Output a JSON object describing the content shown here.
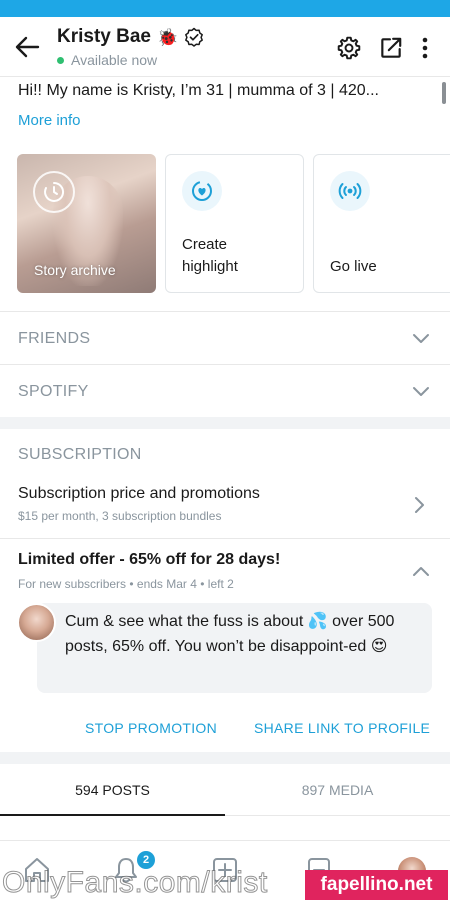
{
  "header": {
    "name": "Kristy Bae",
    "name_emoji": "🐞",
    "status": "Available now"
  },
  "profile": {
    "bio": "Hi!! My name is Kristy, I’m 31 | mumma of 3 | 420...",
    "more_info": "More info"
  },
  "highlights": [
    {
      "label": "Story archive",
      "icon": "clock-archive-icon"
    },
    {
      "label_line1": "Create",
      "label_line2": "highlight",
      "icon": "heart-plus-icon"
    },
    {
      "label": "Go live",
      "icon": "broadcast-icon"
    }
  ],
  "sections": {
    "friends": "FRIENDS",
    "spotify": "SPOTIFY",
    "subscription": "SUBSCRIPTION"
  },
  "subscription": {
    "title": "Subscription price and promotions",
    "desc": "$15 per month, 3 subscription bundles"
  },
  "offer": {
    "title": "Limited offer - 65% off for 28 days!",
    "meta": "For new subscribers  •  ends Mar 4  •  left 2",
    "message": "Cum & see what the fuss is about 💦 over 500 posts, 65% off. You won’t be disappoint-ed 😍",
    "stop_label": "STOP PROMOTION",
    "share_label": "SHARE LINK TO PROFILE"
  },
  "tabs": [
    {
      "label": "594 POSTS"
    },
    {
      "label": "897 MEDIA"
    }
  ],
  "nav": {
    "notifications_count": "2"
  },
  "overlay": {
    "watermark": "OnlyFans.com/krist",
    "brand": "fapellino.net"
  },
  "colors": {
    "accent": "#1ea0d7",
    "status_green": "#2fbf71",
    "brand_pink": "#e0245e"
  }
}
